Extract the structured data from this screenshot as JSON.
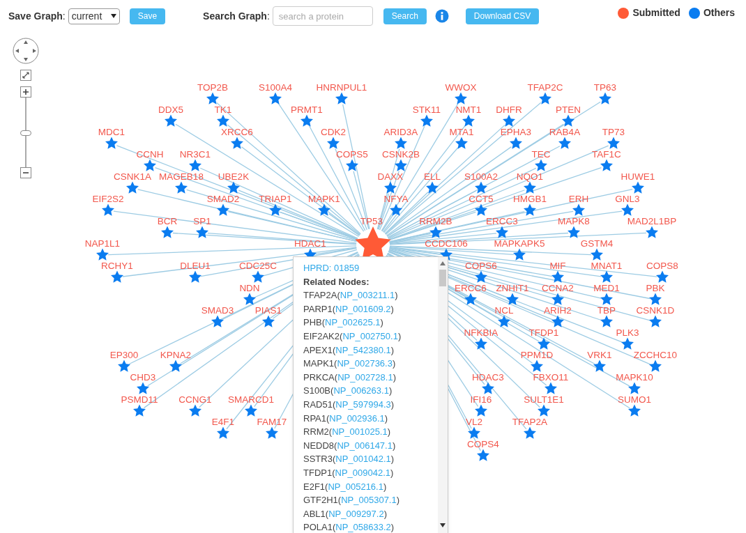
{
  "toolbar": {
    "save_label": "**Save Graph**:",
    "save_select": {
      "value": "current"
    },
    "save_button": "Save",
    "search_label": "**Search Graph**:",
    "search_field": {
      "placeholder": "search a protein"
    },
    "search_button": "Search",
    "download_button": "Download CSV"
  },
  "legend": [
    {
      "label": "Submitted",
      "kind": "submitted",
      "color": "#ff5a36"
    },
    {
      "label": "Others",
      "kind": "other",
      "color": "#0a7cf0"
    }
  ],
  "zoom": {
    "level": 0.48
  },
  "nodes": [
    {
      "label": "TP53",
      "kind": "submitted"
    },
    {
      "label": "TOP2B",
      "kind": "other"
    },
    {
      "label": "S100A4",
      "kind": "other"
    },
    {
      "label": "HNRNPUL1",
      "kind": "other"
    },
    {
      "label": "WWOX",
      "kind": "other"
    },
    {
      "label": "TFAP2C",
      "kind": "other"
    },
    {
      "label": "TP63",
      "kind": "other"
    },
    {
      "label": "DDX5",
      "kind": "other"
    },
    {
      "label": "TK1",
      "kind": "other"
    },
    {
      "label": "PRMT1",
      "kind": "other"
    },
    {
      "label": "STK11",
      "kind": "other"
    },
    {
      "label": "NMT1",
      "kind": "other"
    },
    {
      "label": "DHFR",
      "kind": "other"
    },
    {
      "label": "PTEN",
      "kind": "other"
    },
    {
      "label": "MDC1",
      "kind": "other"
    },
    {
      "label": "XRCC6",
      "kind": "other"
    },
    {
      "label": "CDK2",
      "kind": "other"
    },
    {
      "label": "ARID3A",
      "kind": "other"
    },
    {
      "label": "MTA1",
      "kind": "other"
    },
    {
      "label": "EPHA3",
      "kind": "other"
    },
    {
      "label": "RAB4A",
      "kind": "other"
    },
    {
      "label": "TP73",
      "kind": "other"
    },
    {
      "label": "CCNH",
      "kind": "other"
    },
    {
      "label": "NR3C1",
      "kind": "other"
    },
    {
      "label": "COPS5",
      "kind": "other"
    },
    {
      "label": "CSNK2B",
      "kind": "other"
    },
    {
      "label": "TEC",
      "kind": "other"
    },
    {
      "label": "TAF1C",
      "kind": "other"
    },
    {
      "label": "CSNK1A",
      "kind": "other"
    },
    {
      "label": "MAGEB18",
      "kind": "other"
    },
    {
      "label": "UBE2K",
      "kind": "other"
    },
    {
      "label": "DAXX",
      "kind": "other"
    },
    {
      "label": "ELL",
      "kind": "other"
    },
    {
      "label": "S100A2",
      "kind": "other"
    },
    {
      "label": "NQO1",
      "kind": "other"
    },
    {
      "label": "HUWE1",
      "kind": "other"
    },
    {
      "label": "EIF2S2",
      "kind": "other"
    },
    {
      "label": "SMAD2",
      "kind": "other"
    },
    {
      "label": "TRIAP1",
      "kind": "other"
    },
    {
      "label": "MAPK1",
      "kind": "other"
    },
    {
      "label": "NFYA",
      "kind": "other"
    },
    {
      "label": "CCT5",
      "kind": "other"
    },
    {
      "label": "HMGB1",
      "kind": "other"
    },
    {
      "label": "ERH",
      "kind": "other"
    },
    {
      "label": "GNL3",
      "kind": "other"
    },
    {
      "label": "BCR",
      "kind": "other"
    },
    {
      "label": "SP1",
      "kind": "other"
    },
    {
      "label": "RRM2B",
      "kind": "other"
    },
    {
      "label": "ERCC3",
      "kind": "other"
    },
    {
      "label": "MAPK8",
      "kind": "other"
    },
    {
      "label": "MAD2L1BP",
      "kind": "other"
    },
    {
      "label": "NAP1L1",
      "kind": "other"
    },
    {
      "label": "HDAC1",
      "kind": "other"
    },
    {
      "label": "CCDC106",
      "kind": "other"
    },
    {
      "label": "MAPKAPK5",
      "kind": "other"
    },
    {
      "label": "GSTM4",
      "kind": "other"
    },
    {
      "label": "RCHY1",
      "kind": "other"
    },
    {
      "label": "DLEU1",
      "kind": "other"
    },
    {
      "label": "CDC25C",
      "kind": "other"
    },
    {
      "label": "COPS6",
      "kind": "other"
    },
    {
      "label": "MIF",
      "kind": "other"
    },
    {
      "label": "MNAT1",
      "kind": "other"
    },
    {
      "label": "COPS8",
      "kind": "other"
    },
    {
      "label": "NDN",
      "kind": "other"
    },
    {
      "label": "ERCC6",
      "kind": "other"
    },
    {
      "label": "ZNHIT1",
      "kind": "other"
    },
    {
      "label": "CCNA2",
      "kind": "other"
    },
    {
      "label": "MED1",
      "kind": "other"
    },
    {
      "label": "PBK",
      "kind": "other"
    },
    {
      "label": "SMAD3",
      "kind": "other"
    },
    {
      "label": "PIAS1",
      "kind": "other"
    },
    {
      "label": "NCL",
      "kind": "other"
    },
    {
      "label": "ARIH2",
      "kind": "other"
    },
    {
      "label": "TBP",
      "kind": "other"
    },
    {
      "label": "CSNK1D",
      "kind": "other"
    },
    {
      "label": "NFKBIA",
      "kind": "other"
    },
    {
      "label": "TFDP1",
      "kind": "other"
    },
    {
      "label": "PLK3",
      "kind": "other"
    },
    {
      "label": "EP300",
      "kind": "other"
    },
    {
      "label": "KPNA2",
      "kind": "other"
    },
    {
      "label": "PPM1D",
      "kind": "other"
    },
    {
      "label": "VRK1",
      "kind": "other"
    },
    {
      "label": "ZCCHC10",
      "kind": "other"
    },
    {
      "label": "CHD3",
      "kind": "other"
    },
    {
      "label": "HDAC3",
      "kind": "other"
    },
    {
      "label": "FBXO11",
      "kind": "other"
    },
    {
      "label": "MAPK10",
      "kind": "other"
    },
    {
      "label": "PSMD11",
      "kind": "other"
    },
    {
      "label": "CCNG1",
      "kind": "other"
    },
    {
      "label": "SMARCD1",
      "kind": "other"
    },
    {
      "label": "IFI16",
      "kind": "other"
    },
    {
      "label": "SULT1E1",
      "kind": "other"
    },
    {
      "label": "SUMO1",
      "kind": "other"
    },
    {
      "label": "E4F1",
      "kind": "other"
    },
    {
      "label": "FAM17",
      "kind": "other"
    },
    {
      "label": "VL2",
      "kind": "other"
    },
    {
      "label": "TFAP2A",
      "kind": "other"
    },
    {
      "label": "COPS4",
      "kind": "other"
    }
  ],
  "popup": {
    "title": "HPRD: 01859",
    "heading": "Related Nodes:",
    "brackets": [
      "(",
      ")"
    ],
    "rows": [
      {
        "name": "TFAP2A",
        "id": "NP_003211.1"
      },
      {
        "name": "PARP1",
        "id": "NP_001609.2"
      },
      {
        "name": "PHB",
        "id": "NP_002625.1"
      },
      {
        "name": "EIF2AK2",
        "id": "NP_002750.1"
      },
      {
        "name": "APEX1",
        "id": "NP_542380.1"
      },
      {
        "name": "MAPK1",
        "id": "NP_002736.3"
      },
      {
        "name": "PRKCA",
        "id": "NP_002728.1"
      },
      {
        "name": "S100B",
        "id": "NP_006263.1"
      },
      {
        "name": "RAD51",
        "id": "NP_597994.3"
      },
      {
        "name": "RPA1",
        "id": "NP_002936.1"
      },
      {
        "name": "RRM2",
        "id": "NP_001025.1"
      },
      {
        "name": "NEDD8",
        "id": "NP_006147.1"
      },
      {
        "name": "SSTR3",
        "id": "NP_001042.1"
      },
      {
        "name": "TFDP1",
        "id": "NP_009042.1"
      },
      {
        "name": "E2F1",
        "id": "NP_005216.1"
      },
      {
        "name": "GTF2H1",
        "id": "NP_005307.1"
      },
      {
        "name": "ABL1",
        "id": "NP_009297.2"
      },
      {
        "name": "POLA1",
        "id": "NP_058633.2"
      }
    ]
  }
}
